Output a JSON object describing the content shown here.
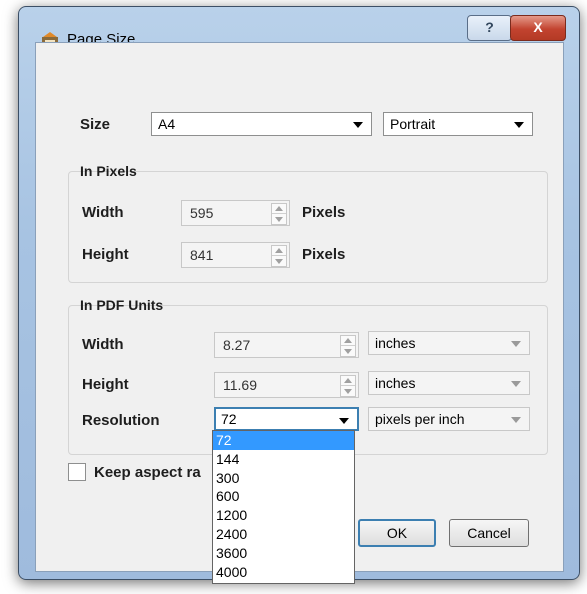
{
  "window": {
    "title": "Page Size",
    "help_label": "?",
    "close_label": "X"
  },
  "size": {
    "label": "Size",
    "value": "A4",
    "orientation": "Portrait"
  },
  "in_pixels": {
    "title": "In Pixels",
    "width_label": "Width",
    "width_value": "595",
    "width_unit": "Pixels",
    "height_label": "Height",
    "height_value": "841",
    "height_unit": "Pixels"
  },
  "in_pdf_units": {
    "title": "In PDF Units",
    "width_label": "Width",
    "width_value": "8.27",
    "width_unit": "inches",
    "height_label": "Height",
    "height_value": "11.69",
    "height_unit": "inches",
    "resolution_label": "Resolution",
    "resolution_value": "72",
    "resolution_unit": "pixels per inch"
  },
  "keep_aspect": {
    "label": "Keep aspect ra",
    "checked": false
  },
  "buttons": {
    "ok": "OK",
    "cancel": "Cancel"
  },
  "resolution_options": [
    "72",
    "144",
    "300",
    "600",
    "1200",
    "2400",
    "3600",
    "4000"
  ],
  "colors": {
    "selection": "#3399ff",
    "focus_border": "#3c7fb1"
  }
}
